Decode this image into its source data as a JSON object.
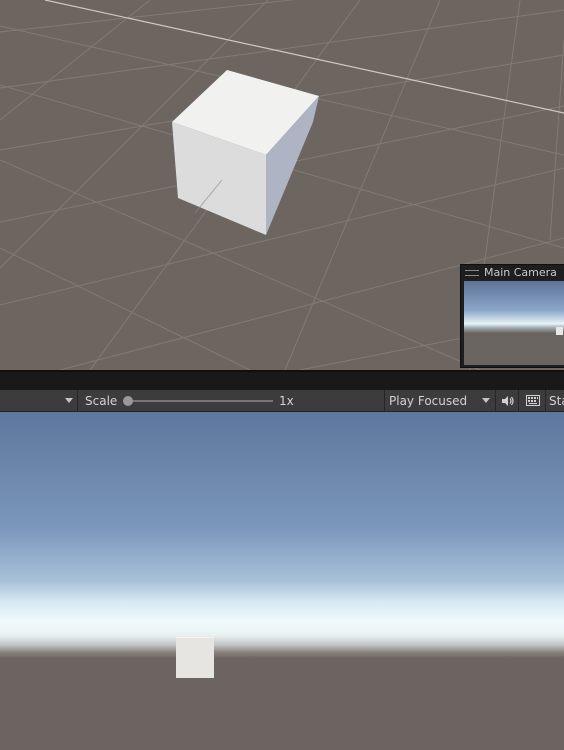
{
  "scene_view": {
    "camera_preview": {
      "title": "Main Camera",
      "handle_icon": "drag-handle-icon"
    }
  },
  "game_toolbar": {
    "display_dropdown_icon": "chevron-down-icon",
    "scale_label": "Scale",
    "scale_value": "1x",
    "play_mode": "Play Focused",
    "mute_icon": "speaker-icon",
    "keyboard_icon": "keyboard-icon",
    "stats_label": "Stats"
  },
  "colors": {
    "scene_bg": "#6c6560",
    "toolbar_bg": "#3c3c3c",
    "sky_top": "#5f779c",
    "horizon": "#f0fafc",
    "ground": "#6b6460",
    "cube": "#e6e5e1"
  }
}
